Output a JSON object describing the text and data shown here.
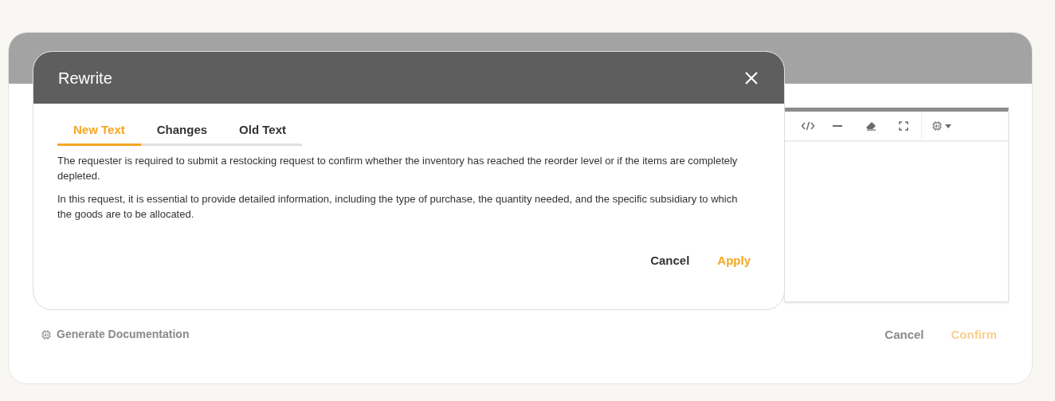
{
  "background_dialog": {
    "footer": {
      "generate_label": "Generate Documentation",
      "buttons": [
        {
          "label": "Cancel",
          "kind": "secondary",
          "disabled": true
        },
        {
          "label": "Confirm",
          "kind": "primary",
          "disabled": true
        }
      ]
    }
  },
  "modal": {
    "title": "Rewrite",
    "tabs": [
      {
        "label": "New Text",
        "selected": true
      },
      {
        "label": "Changes",
        "selected": false
      },
      {
        "label": "Old Text",
        "selected": false
      }
    ],
    "paragraphs": [
      "The requester is required to submit a restocking request to confirm whether the inventory has reached the reorder level or if the items are completely depleted.",
      "In this request, it is essential to provide detailed information, including the type of purchase, the quantity needed, and the specific subsidiary to which the goods are to be allocated."
    ],
    "buttons": [
      {
        "label": "Cancel",
        "kind": "secondary"
      },
      {
        "label": "Apply",
        "kind": "primary"
      }
    ]
  }
}
